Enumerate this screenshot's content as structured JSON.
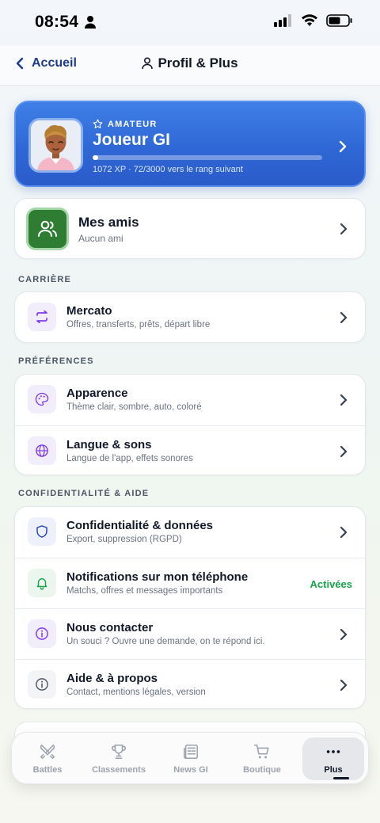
{
  "status_bar": {
    "time": "08:54"
  },
  "nav": {
    "back_label": "Accueil",
    "title": "Profil & Plus"
  },
  "profile": {
    "rank": "AMATEUR",
    "name": "Joueur GI",
    "xp_text": "1072 XP · 72/3000 vers le rang suivant",
    "xp_progress": 0.024
  },
  "friends": {
    "title": "Mes amis",
    "subtitle": "Aucun ami"
  },
  "sections": {
    "career": "CARRIÈRE",
    "preferences": "PRÉFÉRENCES",
    "privacy": "CONFIDENTIALITÉ & AIDE"
  },
  "career_items": [
    {
      "title": "Mercato",
      "subtitle": "Offres, transferts, prêts, départ libre",
      "icon": "swap-arrows-icon"
    }
  ],
  "preference_items": [
    {
      "title": "Apparence",
      "subtitle": "Thème clair, sombre, auto, coloré",
      "icon": "palette-icon"
    },
    {
      "title": "Langue & sons",
      "subtitle": "Langue de l'app, effets sonores",
      "icon": "globe-icon"
    }
  ],
  "privacy_items": [
    {
      "title": "Confidentialité & données",
      "subtitle": "Export, suppression (RGPD)",
      "icon": "shield-icon"
    },
    {
      "title": "Notifications sur mon téléphone",
      "subtitle": "Matchs, offres et messages importants",
      "status": "Activées",
      "icon": "bell-icon"
    },
    {
      "title": "Nous contacter",
      "subtitle": "Un souci ? Ouvre une demande, on te répond ici.",
      "icon": "info-circle-icon"
    },
    {
      "title": "Aide & à propos",
      "subtitle": "Contact, mentions légales, version",
      "icon": "info-icon"
    }
  ],
  "tabs": [
    {
      "label": "Battles",
      "icon": "swords-icon"
    },
    {
      "label": "Classements",
      "icon": "trophy-icon"
    },
    {
      "label": "News GI",
      "icon": "newspaper-icon"
    },
    {
      "label": "Boutique",
      "icon": "cart-icon"
    },
    {
      "label": "Plus",
      "icon": "more-icon",
      "active": true
    }
  ],
  "colors": {
    "accent_blue": "#2f68d6",
    "success_green": "#16a34a",
    "friends_green": "#2e7d32"
  }
}
